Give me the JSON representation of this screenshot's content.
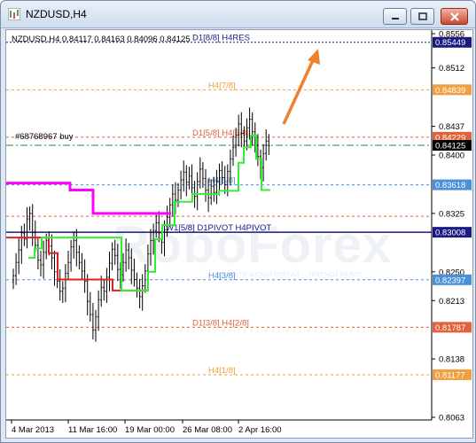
{
  "window": {
    "title": "NZDUSD,H4",
    "chart_header": "NZDUSD,H4  0.84117 0.84163 0.84096 0.84125"
  },
  "colors": {
    "murrey_red": "#e0613a",
    "murrey_orange": "#f0a040",
    "murrey_blue": "#4a90d9",
    "pivot_navy": "#1a1a80",
    "magenta_line": "#ff00ff",
    "green_line": "#33ee33",
    "arrow": "#f08030",
    "ask_line": "#2c8a2c"
  },
  "chart_data": {
    "type": "candlestick",
    "symbol": "NZDUSD",
    "timeframe": "H4",
    "ohlc": {
      "open": 0.84117,
      "high": 0.84163,
      "low": 0.84096,
      "close": 0.84125
    },
    "ylim": [
      0.8063,
      0.8556
    ],
    "y_ticks": [
      0.8556,
      0.8512,
      0.8437,
      0.84,
      0.8325,
      0.825,
      0.8213,
      0.8138,
      0.8063
    ],
    "x_ticks": [
      "4 Mar 2013",
      "11 Mar 16:00",
      "19 Mar 00:00",
      "26 Mar 08:00",
      "2 Apr 16:00"
    ],
    "order_label": "#68768967 buy",
    "levels": [
      {
        "label": "D1[8/8] H4RES",
        "price": 0.85449,
        "tag": "0.85449",
        "kind": "navy"
      },
      {
        "label": "H4[7/8]",
        "price": 0.84839,
        "tag": "0.84839",
        "kind": "orange"
      },
      {
        "label": "D1[5/8] H4[6/8]",
        "price": 0.84229,
        "tag": "0.84229",
        "kind": "red"
      },
      {
        "label": "",
        "price": 0.84125,
        "tag": "0.84125",
        "kind": "current"
      },
      {
        "label": "H4[5/8]",
        "price": 0.83618,
        "tag": "0.83618",
        "kind": "blue"
      },
      {
        "label": "",
        "price": 0.83213,
        "tag": "",
        "kind": "red"
      },
      {
        "label": "W1[5/8] D1PIVOT H4PIVOT",
        "price": 0.83008,
        "tag": "0.83008",
        "kind": "navy"
      },
      {
        "label": "H4[3/8]",
        "price": 0.82397,
        "tag": "0.82397",
        "kind": "blue"
      },
      {
        "label": "D1[3/8] H4[2/8]",
        "price": 0.81787,
        "tag": "0.81787",
        "kind": "red"
      },
      {
        "label": "H4[1/8]",
        "price": 0.81177,
        "tag": "0.81177",
        "kind": "orange"
      }
    ],
    "watermark": "RoboForex",
    "watermark_sub": "АНАЛИТИЧЕСКИЙ ПОРТАЛ — ПРОГНОЗ ВАЛЮТ"
  }
}
